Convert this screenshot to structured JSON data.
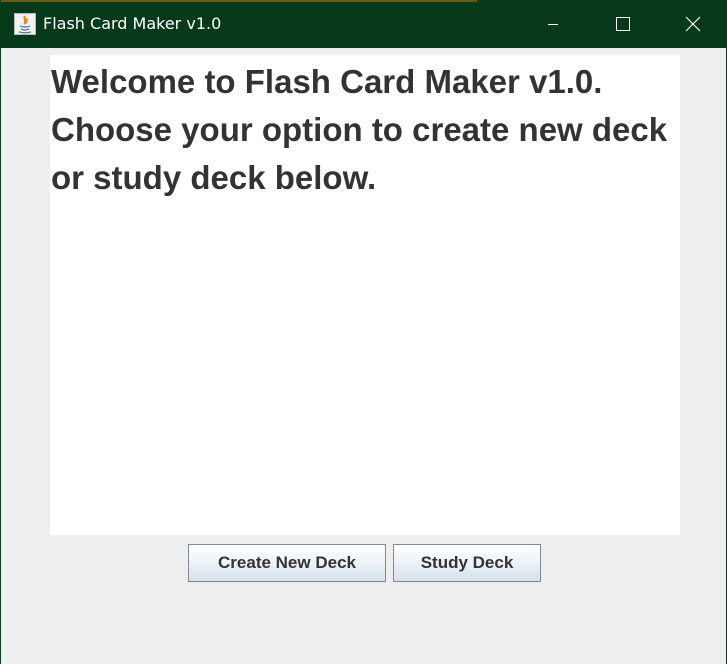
{
  "window": {
    "title": "Flash Card Maker v1.0",
    "controls": {
      "minimize": "minimize-icon",
      "maximize": "maximize-icon",
      "close": "close-icon"
    },
    "titlebar_color": "#063a1b"
  },
  "main": {
    "welcome_text": "Welcome to Flash Card Maker v1.0. Choose your option to create new deck or study deck below."
  },
  "buttons": {
    "create_label": "Create New Deck",
    "study_label": "Study Deck"
  }
}
